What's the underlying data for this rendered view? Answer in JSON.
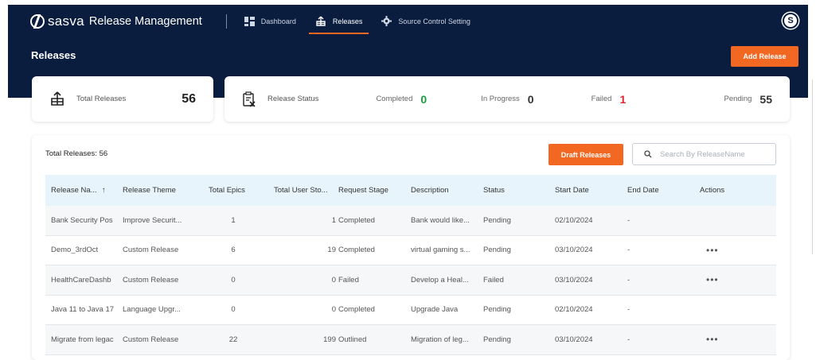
{
  "app": {
    "brand_name": "sasva",
    "title": "Release Management",
    "user_initial": "S"
  },
  "nav": [
    {
      "label": "Dashboard",
      "icon": "dashboard-icon",
      "active": false
    },
    {
      "label": "Releases",
      "icon": "releases-icon",
      "active": true
    },
    {
      "label": "Source Control Setting",
      "icon": "gear-icon",
      "active": false
    }
  ],
  "page": {
    "title": "Releases",
    "add_label": "Add Release"
  },
  "summary": {
    "total_label": "Total Releases",
    "total_value": "56",
    "status_label": "Release Status",
    "completed_label": "Completed",
    "completed_value": "0",
    "inprogress_label": "In Progress",
    "inprogress_value": "0",
    "failed_label": "Failed",
    "failed_value": "1",
    "pending_label": "Pending",
    "pending_value": "55"
  },
  "panel": {
    "caption": "Total Releases: 56",
    "draft_label": "Draft Releases",
    "search_placeholder": "Search By ReleaseName"
  },
  "table": {
    "headers": [
      "Release Na...",
      "Release Theme",
      "Total Epics",
      "Total User Sto...",
      "Request Stage",
      "Description",
      "Status",
      "Start Date",
      "End Date",
      "Actions"
    ],
    "rows": [
      {
        "name": "Bank Security Pos",
        "theme": "Improve Securit...",
        "epics": "1",
        "stories": "1",
        "stage": "Completed",
        "desc": "Bank would like...",
        "status": "Pending",
        "start": "02/10/2024",
        "end": "-",
        "actions": ""
      },
      {
        "name": "Demo_3rdOct",
        "theme": "Custom Release",
        "epics": "6",
        "stories": "19",
        "stage": "Completed",
        "desc": "virtual gaming s...",
        "status": "Pending",
        "start": "03/10/2024",
        "end": "-",
        "actions": "•••"
      },
      {
        "name": "HealthCareDashb",
        "theme": "Custom Release",
        "epics": "0",
        "stories": "0",
        "stage": "Failed",
        "desc": "Develop a Heal...",
        "status": "Failed",
        "start": "03/10/2024",
        "end": "-",
        "actions": "•••"
      },
      {
        "name": "Java 11 to Java 17",
        "theme": "Language Upgr...",
        "epics": "0",
        "stories": "0",
        "stage": "Completed",
        "desc": "Upgrade Java",
        "status": "Pending",
        "start": "02/10/2024",
        "end": "-",
        "actions": ""
      },
      {
        "name": "Migrate from legac",
        "theme": "Custom Release",
        "epics": "22",
        "stories": "199",
        "stage": "Outlined",
        "desc": "Migration of leg...",
        "status": "Pending",
        "start": "03/10/2024",
        "end": "-",
        "actions": "•••"
      }
    ]
  },
  "colors": {
    "navy": "#0b1d3f",
    "accent": "#f26722",
    "success": "#1a9e3c",
    "danger": "#e0232f",
    "header_row": "#e8f4fc"
  }
}
